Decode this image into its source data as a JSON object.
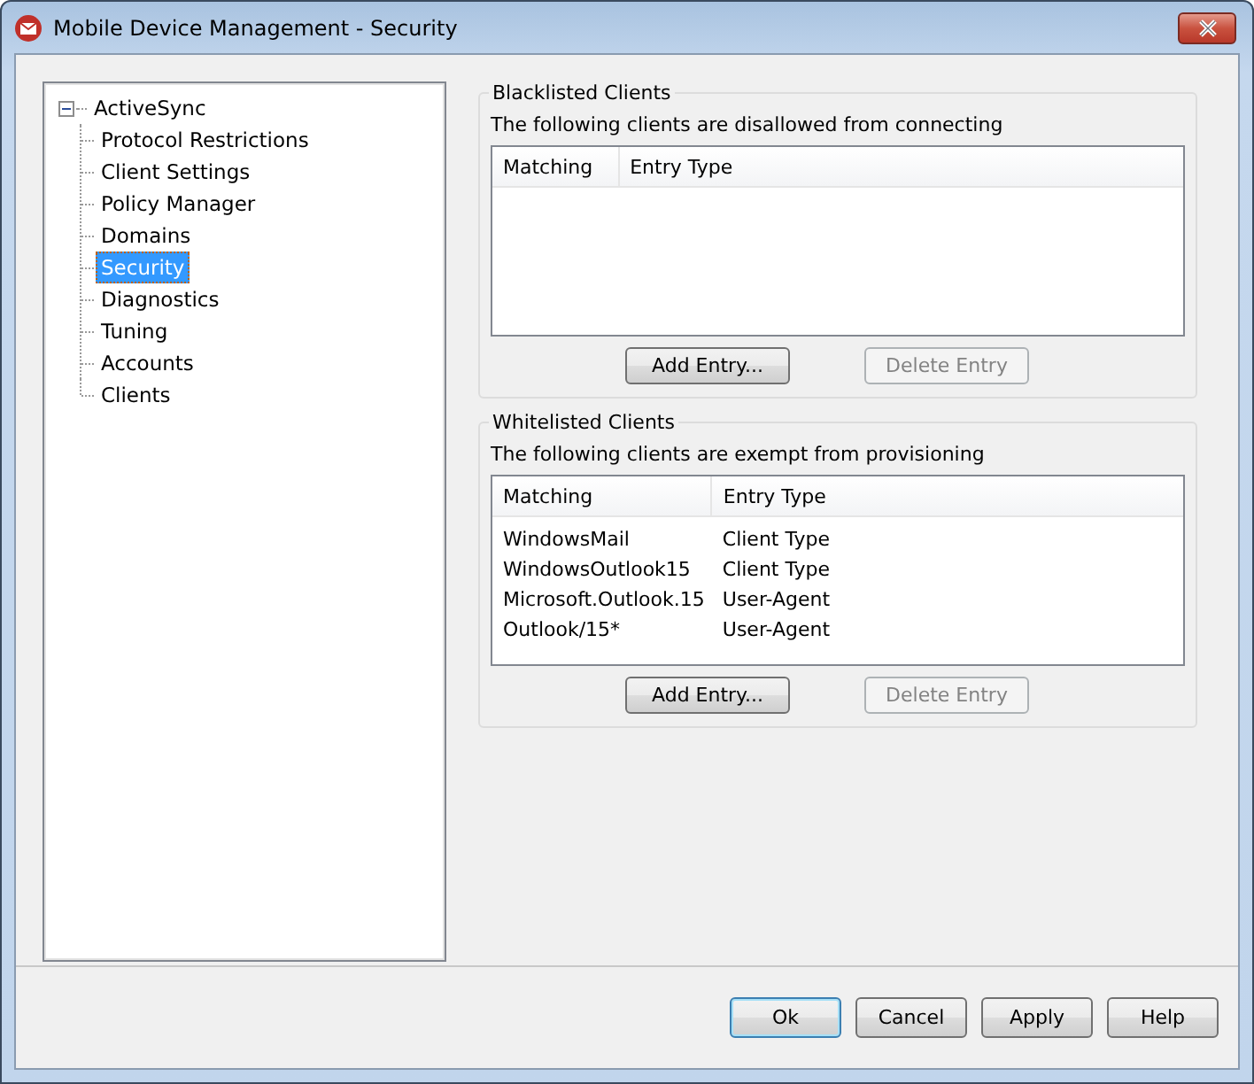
{
  "window": {
    "title": "Mobile Device Management - Security"
  },
  "tree": {
    "label": "ActiveSync",
    "expanded": true,
    "children": [
      {
        "label": "Protocol Restrictions",
        "selected": false
      },
      {
        "label": "Client Settings",
        "selected": false
      },
      {
        "label": "Policy Manager",
        "selected": false
      },
      {
        "label": "Domains",
        "selected": false
      },
      {
        "label": "Security",
        "selected": true
      },
      {
        "label": "Diagnostics",
        "selected": false
      },
      {
        "label": "Tuning",
        "selected": false
      },
      {
        "label": "Accounts",
        "selected": false
      },
      {
        "label": "Clients",
        "selected": false
      }
    ]
  },
  "groups": [
    {
      "title": "Blacklisted Clients",
      "description": "The following clients are disallowed from connecting",
      "columns": [
        "Matching",
        "Entry Type"
      ],
      "buttons": [
        {
          "label": "Add Entry...",
          "disabled": false
        },
        {
          "label": "Delete Entry",
          "disabled": true
        }
      ]
    },
    {
      "title": "Whitelisted Clients",
      "description": "The following clients are exempt from provisioning",
      "columns": [
        "Matching",
        "Entry Type"
      ],
      "rows": [
        [
          "WindowsMail",
          "Client Type"
        ],
        [
          "WindowsOutlook15",
          "Client Type"
        ],
        [
          "Microsoft.Outlook.15",
          "User-Agent"
        ],
        [
          "Outlook/15*",
          "User-Agent"
        ]
      ],
      "buttons": [
        {
          "label": "Add Entry...",
          "disabled": false
        },
        {
          "label": "Delete Entry",
          "disabled": true
        }
      ]
    }
  ],
  "footer_buttons": [
    {
      "label": "Ok",
      "default": true
    },
    {
      "label": "Cancel",
      "default": false
    },
    {
      "label": "Apply",
      "default": false
    },
    {
      "label": "Help",
      "default": false
    }
  ]
}
